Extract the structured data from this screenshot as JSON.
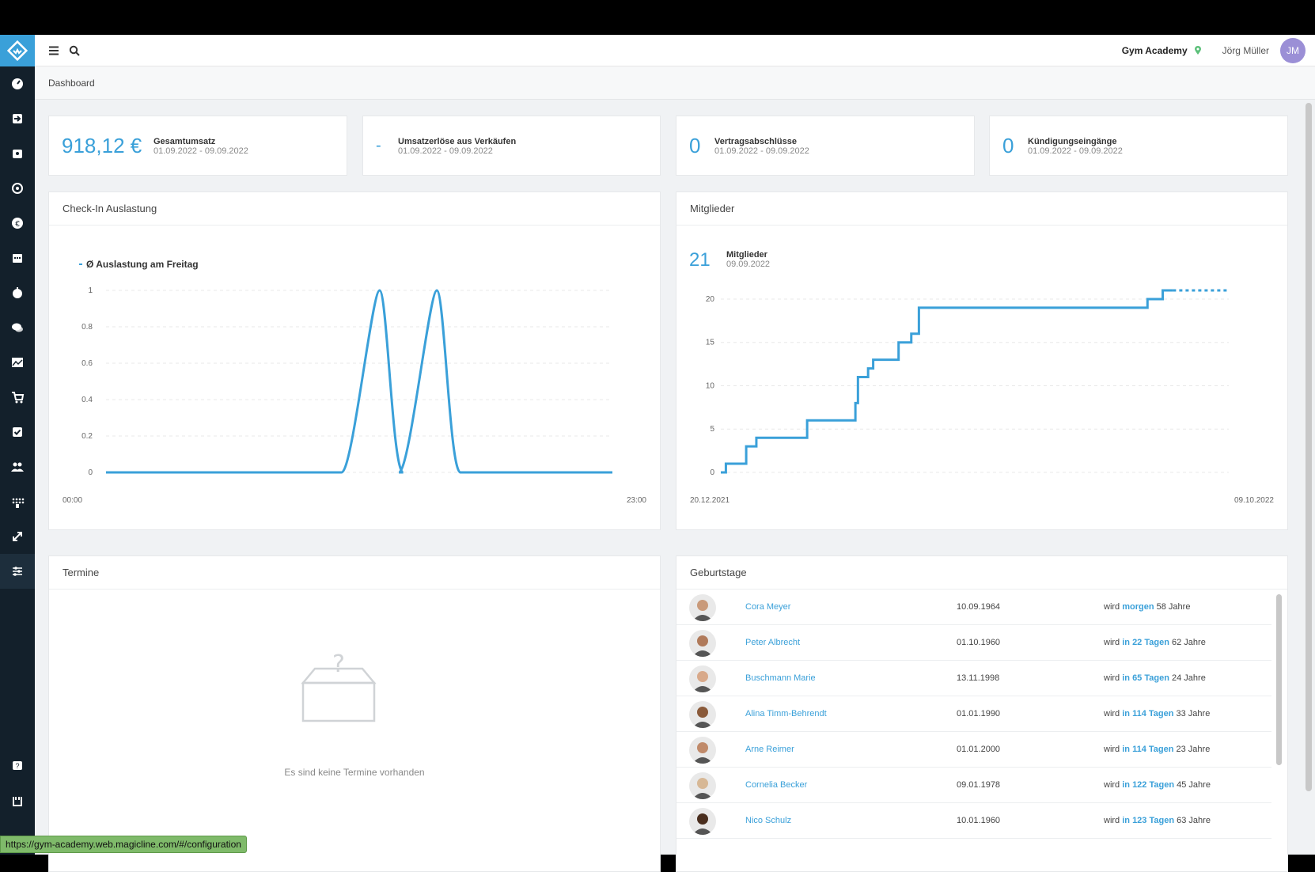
{
  "topbar": {
    "studio": "Gym Academy",
    "user": "Jörg Müller",
    "avatar": "JM"
  },
  "breadcrumb": "Dashboard",
  "kpis": [
    {
      "value": "918,12 €",
      "title": "Gesamtumsatz",
      "range": "01.09.2022 - 09.09.2022"
    },
    {
      "value": "-",
      "title": "Umsatzerlöse aus Verkäufen",
      "range": "01.09.2022 - 09.09.2022"
    },
    {
      "value": "0",
      "title": "Vertragsabschlüsse",
      "range": "01.09.2022 - 09.09.2022"
    },
    {
      "value": "0",
      "title": "Kündigungseingänge",
      "range": "01.09.2022 - 09.09.2022"
    }
  ],
  "checkin": {
    "title": "Check-In Auslastung",
    "legend": "Ø Auslastung am Freitag",
    "x_start": "00:00",
    "x_end": "23:00"
  },
  "members": {
    "title": "Mitglieder",
    "value": "21",
    "label": "Mitglieder",
    "date": "09.09.2022",
    "x_start": "20.12.2021",
    "x_end": "09.10.2022"
  },
  "termine": {
    "title": "Termine",
    "empty": "Es sind keine Termine vorhanden"
  },
  "birthdays": {
    "title": "Geburtstage",
    "rows": [
      {
        "name": "Cora Meyer",
        "date": "10.09.1964",
        "prefix": "wird",
        "when": "morgen",
        "age": "58 Jahre"
      },
      {
        "name": "Peter Albrecht",
        "date": "01.10.1960",
        "prefix": "wird",
        "when": "in 22 Tagen",
        "age": "62 Jahre"
      },
      {
        "name": "Buschmann Marie",
        "date": "13.11.1998",
        "prefix": "wird",
        "when": "in 65 Tagen",
        "age": "24 Jahre"
      },
      {
        "name": "Alina Timm-Behrendt",
        "date": "01.01.1990",
        "prefix": "wird",
        "when": "in 114 Tagen",
        "age": "33 Jahre"
      },
      {
        "name": "Arne Reimer",
        "date": "01.01.2000",
        "prefix": "wird",
        "when": "in 114 Tagen",
        "age": "23 Jahre"
      },
      {
        "name": "Cornelia Becker",
        "date": "09.01.1978",
        "prefix": "wird",
        "when": "in 122 Tagen",
        "age": "45 Jahre"
      },
      {
        "name": "Nico Schulz",
        "date": "10.01.1960",
        "prefix": "wird",
        "when": "in 123 Tagen",
        "age": "63 Jahre"
      }
    ]
  },
  "status_url": "https://gym-academy.web.magicline.com/#/configuration",
  "chart_data": [
    {
      "type": "line",
      "title": "Check-In Auslastung",
      "series": [
        {
          "name": "Ø Auslastung am Freitag",
          "x": [
            "00:00",
            "08:00",
            "10:00",
            "10:30",
            "11:00",
            "12:00",
            "13:00",
            "14:00",
            "14:30",
            "15:00",
            "16:00",
            "23:00"
          ],
          "values": [
            0,
            0,
            0,
            1,
            0,
            0,
            0,
            1,
            0,
            0,
            0,
            0
          ]
        }
      ],
      "yticks": [
        0,
        0.2,
        0.4,
        0.6,
        0.8,
        1
      ],
      "ylim": [
        0,
        1
      ]
    },
    {
      "type": "line",
      "title": "Mitglieder",
      "x": [
        "20.12.2021",
        "09.10.2022"
      ],
      "values": [
        0,
        1,
        3,
        4,
        6,
        8,
        11,
        12,
        13,
        15,
        16,
        19,
        20,
        21
      ],
      "yticks": [
        0,
        5,
        10,
        15,
        20
      ],
      "ylim": [
        0,
        21
      ]
    }
  ]
}
